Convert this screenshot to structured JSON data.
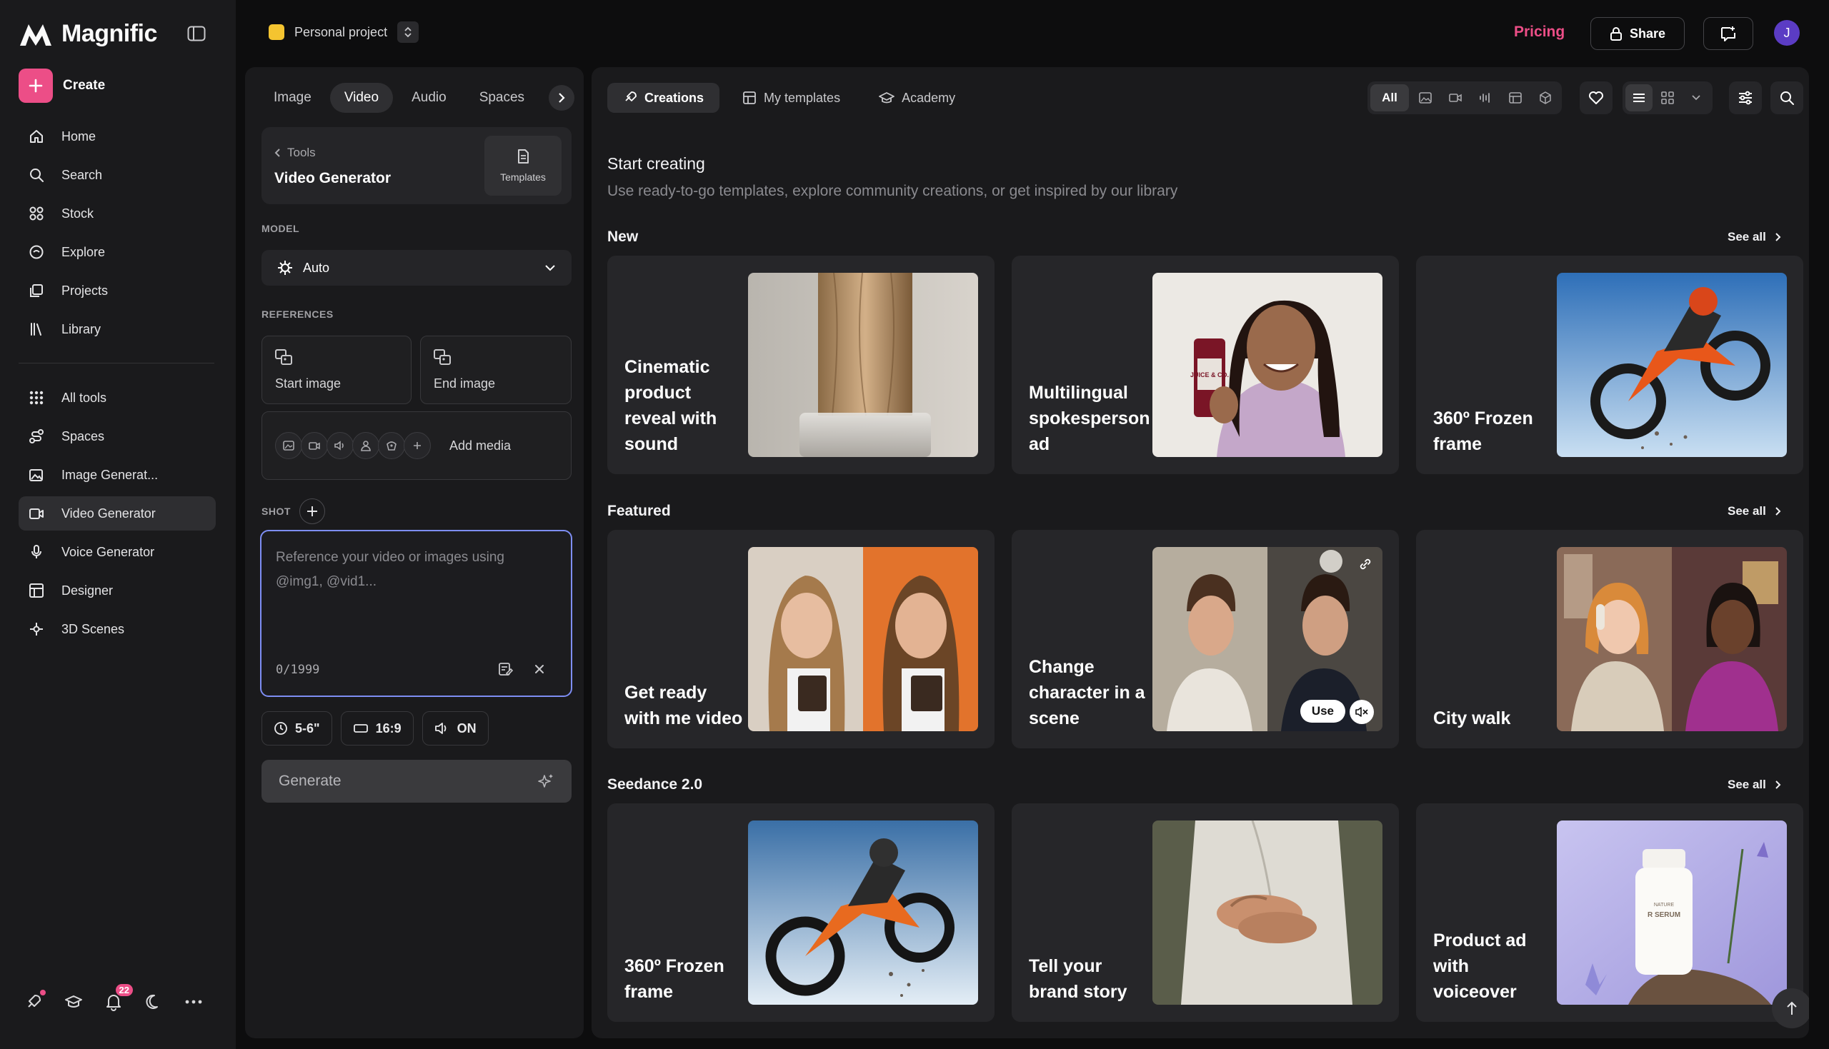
{
  "app": {
    "name": "Magnific"
  },
  "sidebar": {
    "create_label": "Create",
    "items_primary": [
      {
        "label": "Home",
        "icon": "home-icon"
      },
      {
        "label": "Search",
        "icon": "search-icon"
      },
      {
        "label": "Stock",
        "icon": "stock-icon"
      },
      {
        "label": "Explore",
        "icon": "explore-icon"
      },
      {
        "label": "Projects",
        "icon": "projects-icon"
      },
      {
        "label": "Library",
        "icon": "library-icon"
      }
    ],
    "items_tools": [
      {
        "label": "All tools",
        "icon": "grid-icon"
      },
      {
        "label": "Spaces",
        "icon": "spaces-icon"
      },
      {
        "label": "Image Generat...",
        "icon": "image-icon"
      },
      {
        "label": "Video Generator",
        "icon": "video-icon",
        "active": true
      },
      {
        "label": "Voice Generator",
        "icon": "mic-icon"
      },
      {
        "label": "Designer",
        "icon": "designer-icon"
      },
      {
        "label": "3D Scenes",
        "icon": "cube-icon"
      }
    ],
    "notifications_count": "22"
  },
  "topbar": {
    "project_label": "Personal project",
    "pricing_label": "Pricing",
    "share_label": "Share",
    "avatar_initial": "J"
  },
  "panel": {
    "tabs": [
      "Image",
      "Video",
      "Audio",
      "Spaces"
    ],
    "active_tab": "Video",
    "tools_back": "Tools",
    "tool_title": "Video Generator",
    "templates_label": "Templates",
    "model_label": "MODEL",
    "model_value": "Auto",
    "references_label": "REFERENCES",
    "start_image": "Start image",
    "end_image": "End image",
    "add_media": "Add media",
    "shot_label": "SHOT",
    "prompt_placeholder": "Reference your video or images using @img1, @vid1...",
    "char_count": "0/1999",
    "duration": "5-6\"",
    "aspect": "16:9",
    "sound": "ON",
    "generate_label": "Generate"
  },
  "main": {
    "tabs": [
      "Creations",
      "My templates",
      "Academy"
    ],
    "filter_all": "All",
    "start_title": "Start creating",
    "start_sub": "Use ready-to-go templates, explore community creations, or get inspired by our library",
    "see_all": "See all",
    "sections": [
      {
        "title": "New",
        "cards": [
          "Cinematic product reveal with sound",
          "Multilingual spokesperson ad",
          "360º Frozen frame"
        ]
      },
      {
        "title": "Featured",
        "cards": [
          "Get ready with me video",
          "Change character in a scene",
          "City walk"
        ]
      },
      {
        "title": "Seedance 2.0",
        "cards": [
          "360º Frozen frame",
          "Tell your brand story",
          "Product ad with voiceover"
        ]
      }
    ],
    "use_label": "Use",
    "bottle_label": "JUICE & CO.",
    "serum_label": "R SERUM",
    "serum_brand": "NATURE"
  },
  "colors": {
    "accent": "#ec4e87",
    "prompt_border": "#7e8ef4",
    "project_dot": "#f4c430",
    "avatar": "#5b3cc4"
  }
}
